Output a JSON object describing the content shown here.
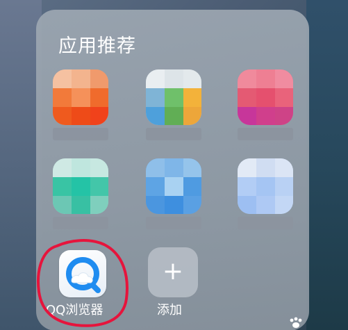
{
  "folder": {
    "title": "应用推荐"
  },
  "apps": [
    {
      "label": "QQ浏览器",
      "icon": "qq-browser-icon",
      "accent": "#1f8cf0"
    },
    {
      "label": "添加",
      "icon": "plus-icon"
    }
  ],
  "colors": {
    "highlight": "#e6143c",
    "qq_blue": "#1f8cf0"
  }
}
